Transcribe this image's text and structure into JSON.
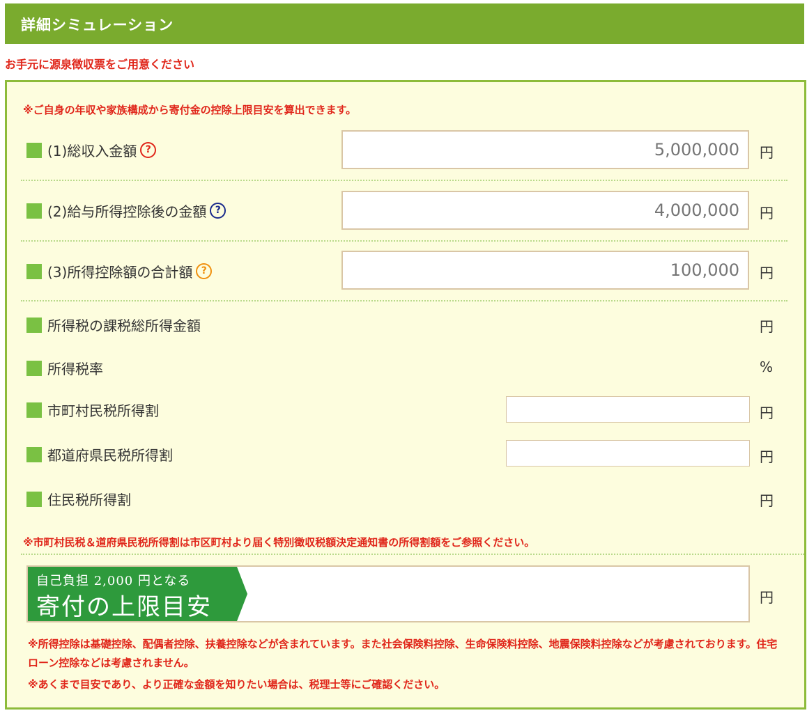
{
  "header": {
    "title": "詳細シミュレーション"
  },
  "notice_top": "お手元に源泉徴収票をご用意ください",
  "panel": {
    "intro": "※ご自身の年収や家族構成から寄付金の控除上限目安を算出できます。",
    "rows": [
      {
        "label": "(1)総収入金額",
        "help": "?",
        "placeholder": "5,000,000",
        "unit": "円"
      },
      {
        "label": "(2)給与所得控除後の金額",
        "help": "?",
        "placeholder": "4,000,000",
        "unit": "円"
      },
      {
        "label": "(3)所得控除額の合計額",
        "help": "?",
        "placeholder": "100,000",
        "unit": "円"
      }
    ],
    "results": [
      {
        "label": "所得税の課税総所得金額",
        "unit": "円"
      },
      {
        "label": "所得税率",
        "unit": "%"
      },
      {
        "label": "市町村民税所得割",
        "unit": "円"
      },
      {
        "label": "都道府県民税所得割",
        "unit": "円"
      },
      {
        "label": "住民税所得割",
        "unit": "円"
      }
    ],
    "municipal_note": "※市町村民税＆道府県民税所得割は市区町村より届く特別徴収税額決定通知書の所得割額をご参照ください。",
    "donation": {
      "small": "自己負担 2,000 円となる",
      "big": "寄付の上限目安",
      "unit": "円"
    },
    "footnote1": "※所得控除は基礎控除、配偶者控除、扶養控除などが含まれています。また社会保険料控除、生命保険料控除、地震保険料控除などが考慮されております。住宅ローン控除などは考慮されません。",
    "footnote2": "※あくまで目安であり、より正確な金額を知りたい場合は、税理士等にご確認ください。"
  },
  "colors": {
    "header_green": "#7aab2e",
    "square_green": "#7ac143",
    "alert_red": "#e0261a",
    "panel_bg": "#fdfdde",
    "help_red": "#e0261a",
    "help_navy": "#1a2b8c",
    "help_orange": "#f0900e"
  },
  "icons": [
    "help-circle-icon"
  ]
}
